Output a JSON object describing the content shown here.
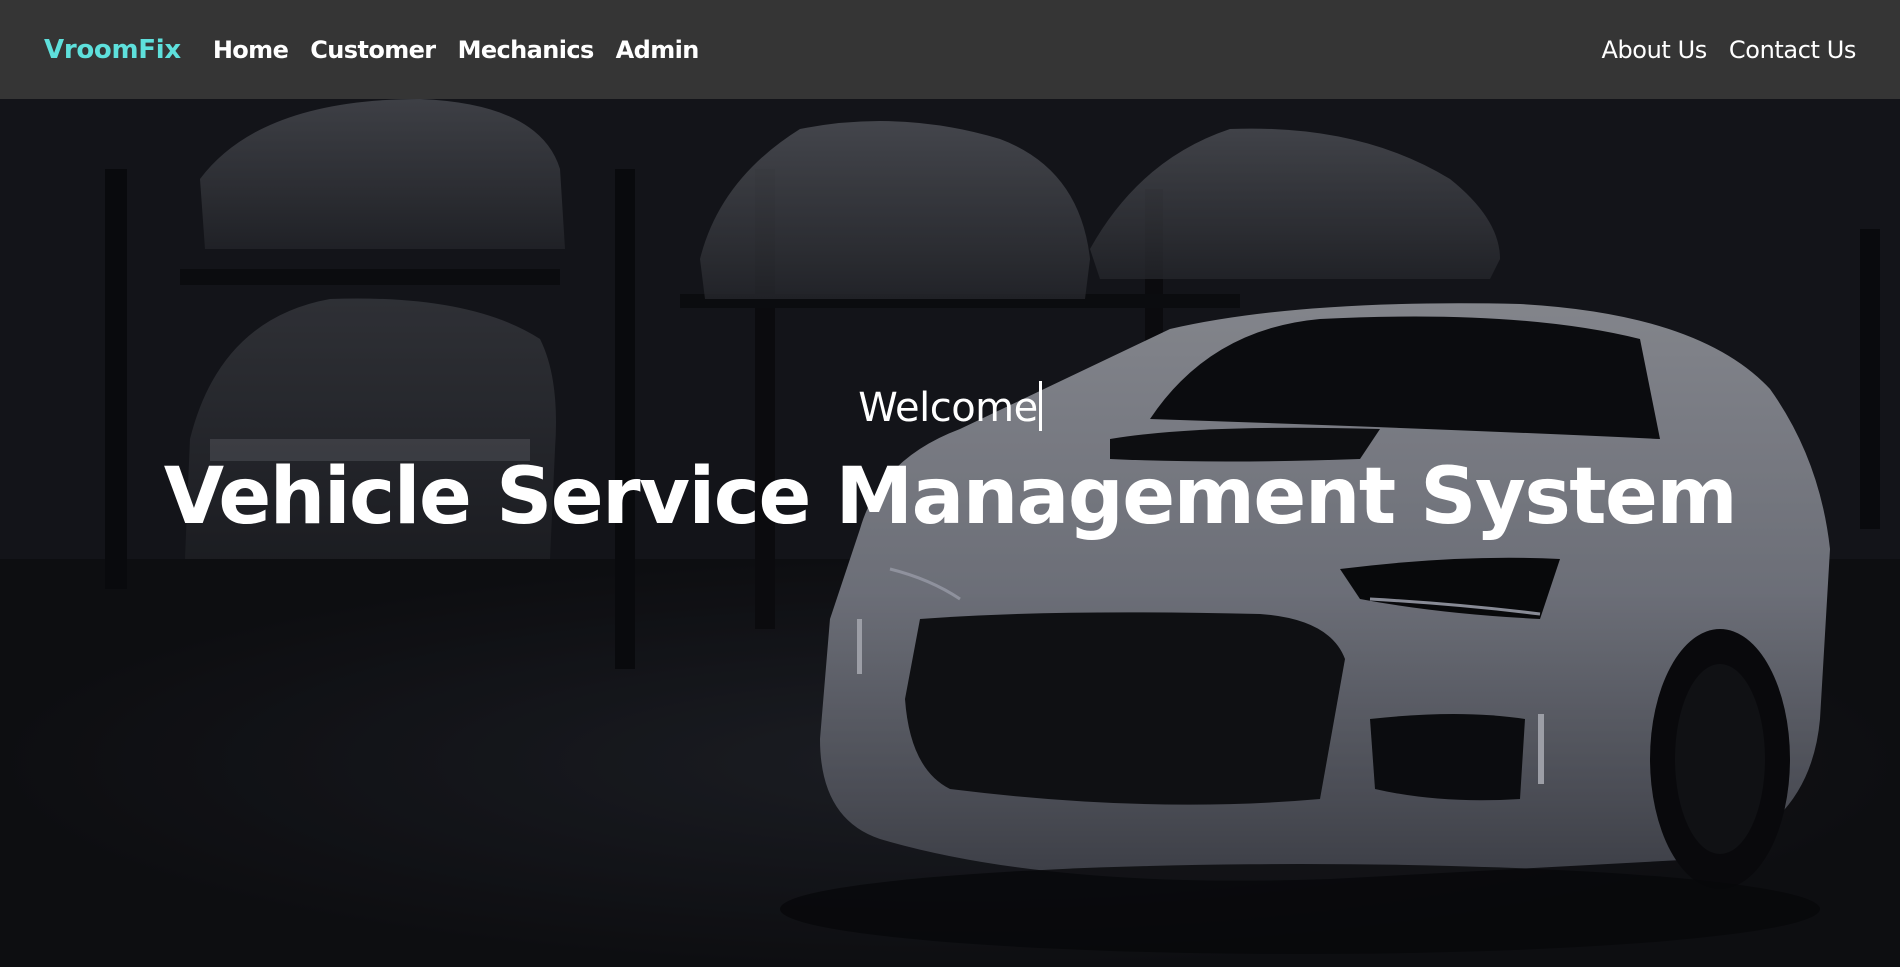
{
  "nav": {
    "brand": "VroomFix",
    "left_links": [
      "Home",
      "Customer",
      "Mechanics",
      "Admin"
    ],
    "right_links": [
      "About Us",
      "Contact Us"
    ]
  },
  "hero": {
    "welcome": "Welcome",
    "title": "Vehicle Service Management System",
    "background_image": "garage-sports-cars-photo"
  },
  "colors": {
    "navbar_bg": "#353535",
    "brand": "#5ee0dc",
    "text": "#ffffff"
  }
}
